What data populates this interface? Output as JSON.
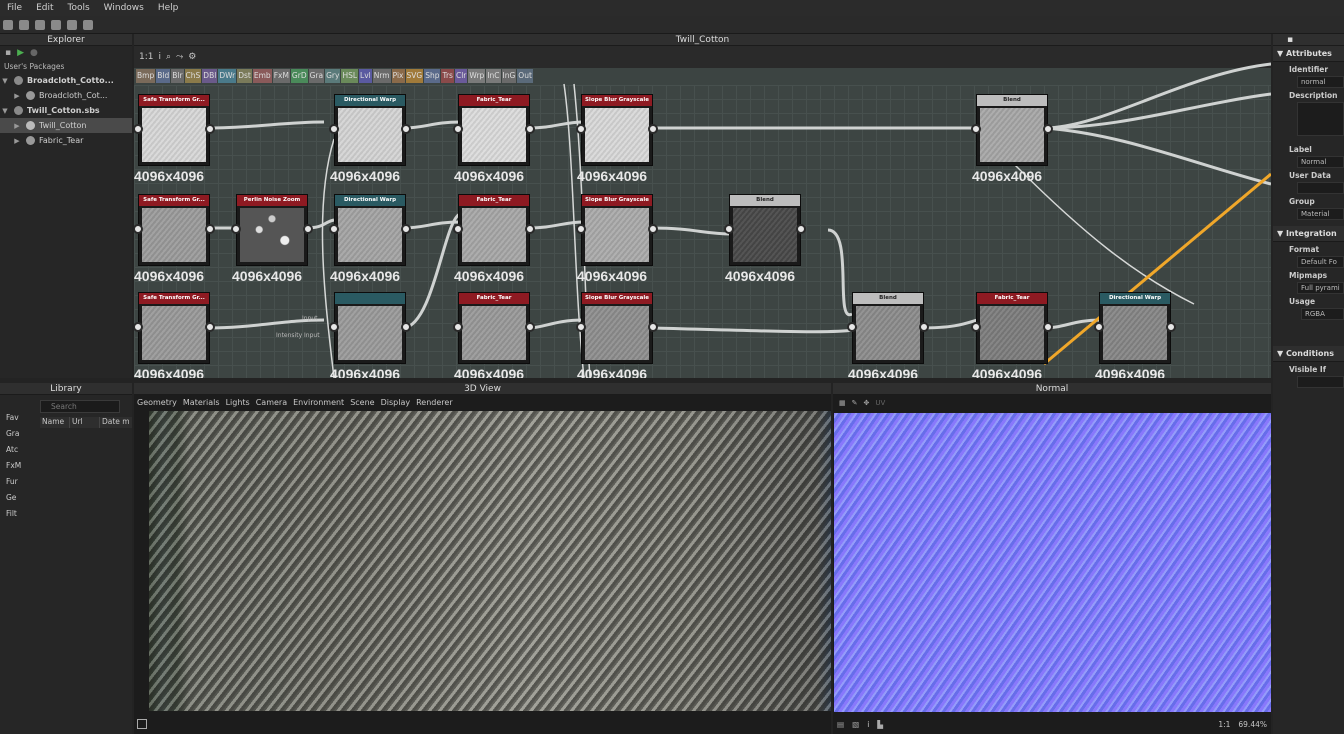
{
  "menu": [
    "File",
    "Edit",
    "Tools",
    "Windows",
    "Help"
  ],
  "explorer": {
    "title": "Explorer",
    "section": "User's Packages",
    "items": [
      {
        "label": "Broadcloth_Cotto...",
        "bold": true,
        "level": 0
      },
      {
        "label": "Broadcloth_Cot...",
        "bold": false,
        "level": 1
      },
      {
        "label": "Twill_Cotton.sbs",
        "bold": true,
        "level": 0
      },
      {
        "label": "Twill_Cotton",
        "bold": false,
        "level": 1,
        "selected": true
      },
      {
        "label": "Fabric_Tear",
        "bold": false,
        "level": 1
      }
    ]
  },
  "graph": {
    "title": "Twill_Cotton",
    "zoom": "1:1",
    "filters": [
      "Bmp",
      "Bld",
      "Blr",
      "ChS",
      "DBl",
      "DWr",
      "Dst",
      "Emb",
      "FxM",
      "GrD",
      "Gra",
      "Gry",
      "HSL",
      "Lvl",
      "Nrm",
      "Pix",
      "SVG",
      "Shp",
      "Trs",
      "Clr",
      "Wrp",
      "InC",
      "InG",
      "Out"
    ],
    "resolution": "4096x4096",
    "nodes": [
      {
        "title": "Safe Transform Gr...",
        "color": "#8e1a22"
      },
      {
        "title": "Directional Warp",
        "color": "#2a5a62"
      },
      {
        "title": "Fabric_Tear",
        "color": "#8e1a22"
      },
      {
        "title": "Slope Blur Grayscale",
        "color": "#8e1a22"
      },
      {
        "title": "Blend",
        "color": "#bdbdbd"
      },
      {
        "title": "Safe Transform Gr...",
        "color": "#8e1a22"
      },
      {
        "title": "Perlin Noise Zoom",
        "color": "#8e1a22"
      },
      {
        "title": "Directional Warp",
        "color": "#2a5a62"
      },
      {
        "title": "Fabric_Tear",
        "color": "#8e1a22"
      },
      {
        "title": "Slope Blur Grayscale",
        "color": "#8e1a22"
      },
      {
        "title": "Blend",
        "color": "#bdbdbd"
      },
      {
        "title": "Safe Transform Gr...",
        "color": "#8e1a22"
      },
      {
        "title": "",
        "color": "#2a5a62"
      },
      {
        "title": "Fabric_Tear",
        "color": "#8e1a22"
      },
      {
        "title": "Slope Blur Grayscale",
        "color": "#8e1a22"
      },
      {
        "title": "Blend",
        "color": "#bdbdbd"
      },
      {
        "title": "Fabric_Tear",
        "color": "#8e1a22"
      },
      {
        "title": "Directional Warp",
        "color": "#2a5a62"
      }
    ],
    "port_labels": [
      "Input",
      "Intensity Input"
    ]
  },
  "library": {
    "title": "Library",
    "search_placeholder": "Search",
    "columns": [
      "Name",
      "Url",
      "Date m"
    ],
    "side_items": [
      "Fav",
      "Gra",
      "Atc",
      "FxM",
      "Fur",
      "Ge",
      "Filt"
    ]
  },
  "view3d": {
    "title": "3D View",
    "menu": [
      "Geometry",
      "Materials",
      "Lights",
      "Camera",
      "Environment",
      "Scene",
      "Display",
      "Renderer"
    ]
  },
  "normal": {
    "title": "Normal",
    "uv": "UV",
    "zoom_ratio": "1:1",
    "zoom": "69.44%"
  },
  "props": {
    "sections": {
      "attributes": "Attributes",
      "integration": "Integration",
      "conditions": "Conditions"
    },
    "identifier_label": "Identifier",
    "identifier_value": "normal",
    "description_label": "Description",
    "label_label": "Label",
    "label_value": "Normal",
    "user_data_label": "User Data",
    "group_label": "Group",
    "group_value": "Material",
    "format_label": "Format",
    "format_value": "Default Fo",
    "mipmaps_label": "Mipmaps",
    "mipmaps_value": "Full pyrami",
    "usage_label": "Usage",
    "usage_value": "RGBA",
    "visible_if_label": "Visible If"
  },
  "colors": {
    "accent_wire": "#f0a72a",
    "node_red": "#8e1a22",
    "node_teal": "#2a5a62"
  }
}
